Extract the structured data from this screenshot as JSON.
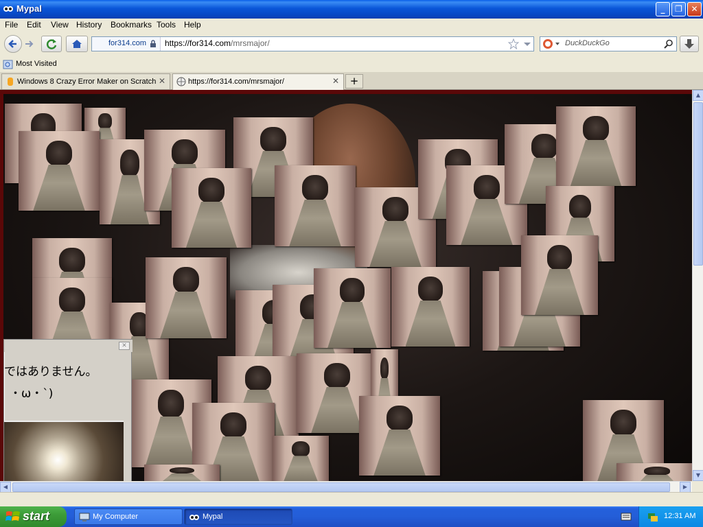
{
  "window": {
    "title": "Mypal",
    "controls": {
      "minimize": "_",
      "maximize": "❐",
      "close": "✕"
    }
  },
  "menu": [
    "File",
    "Edit",
    "View",
    "History",
    "Bookmarks",
    "Tools",
    "Help"
  ],
  "nav": {
    "identity": "for314.com",
    "url_host": "https://for314.com",
    "url_path": "/mrsmajor/",
    "search_placeholder": "DuckDuckGo"
  },
  "bookmarks": {
    "most_visited": "Most Visited"
  },
  "tabs": [
    {
      "label": "Windows 8 Crazy Error Maker on Scratch",
      "active": false
    },
    {
      "label": "https://for314.com/mrsmajor/",
      "active": true
    }
  ],
  "new_tab_symbol": "+",
  "dialog": {
    "line1": "ではありません。",
    "line2": "・ω・`)"
  },
  "taskbar": {
    "start": "start",
    "items": [
      {
        "label": "My Computer",
        "active": false
      },
      {
        "label": "Mypal",
        "active": true
      }
    ],
    "clock": "12:31 AM"
  },
  "colors": {
    "title_blue": "#0a56d8",
    "start_green": "#3c9c38",
    "frame_red": "#5a0808"
  }
}
